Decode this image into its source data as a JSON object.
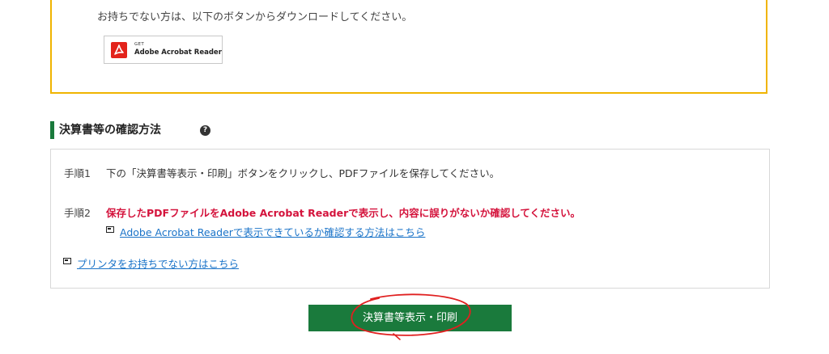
{
  "notice": {
    "text": "お持ちでない方は、以下のボタンからダウンロードしてください。",
    "acrobat_button": {
      "get_label": "GET",
      "name": "Adobe Acrobat Reader",
      "icon": "adobe-acrobat-icon",
      "icon_color": "#e3231b"
    },
    "border_color": "#f0b400"
  },
  "section": {
    "title": "決算書等の確認方法",
    "help_icon": "question-circle-icon",
    "help_glyph": "?",
    "accent_color": "#1a7a3c"
  },
  "steps": [
    {
      "number": "手順1",
      "text": "下の「決算書等表示・印刷」ボタンをクリックし、PDFファイルを保存してください。"
    },
    {
      "number": "手順2",
      "text": "保存したPDFファイルをAdobe Acrobat Readerで表示し、内容に誤りがないか確認してください。",
      "text_color": "#d4133c",
      "link": "Adobe Acrobat Readerで表示できているか確認する方法はこちら"
    }
  ],
  "printer_link": "プリンタをお持ちでない方はこちら",
  "print_button": {
    "label": "決算書等表示・印刷",
    "color": "#1a7a3c"
  },
  "annotation": {
    "shape": "hand-drawn-ellipse",
    "color": "#e02020"
  }
}
